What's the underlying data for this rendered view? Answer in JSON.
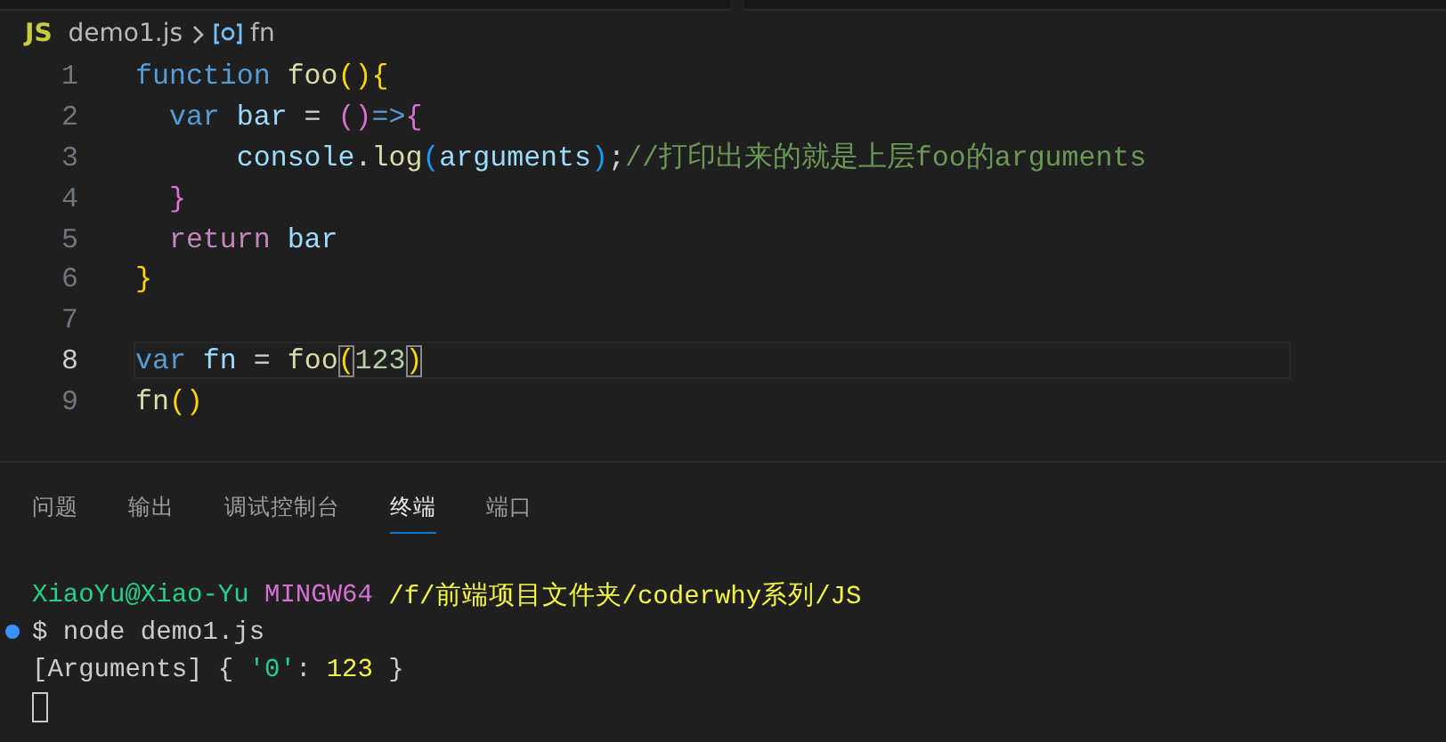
{
  "breadcrumb": {
    "file_icon": "JS",
    "file": "demo1.js",
    "symbol": "fn"
  },
  "editor": {
    "lines": [
      {
        "number": "1",
        "current": false,
        "tokens": [
          {
            "text": "function",
            "kind": "keyword"
          },
          {
            "text": " foo",
            "kind": "function"
          },
          {
            "text": "()",
            "kind": "bracket1"
          },
          {
            "text": "{",
            "kind": "bracket1"
          }
        ]
      },
      {
        "number": "2",
        "current": false,
        "tokens": [
          {
            "text": "  var",
            "kind": "keyword"
          },
          {
            "text": " bar",
            "kind": "variable"
          },
          {
            "text": " =",
            "kind": "plain"
          },
          {
            "text": " ()",
            "kind": "bracket2"
          },
          {
            "text": "=>",
            "kind": "keyword"
          },
          {
            "text": "{",
            "kind": "bracket2"
          }
        ]
      },
      {
        "number": "3",
        "current": false,
        "tokens": [
          {
            "text": "      console",
            "kind": "variable"
          },
          {
            "text": ".",
            "kind": "plain"
          },
          {
            "text": "log",
            "kind": "function"
          },
          {
            "text": "(",
            "kind": "bracket3"
          },
          {
            "text": "arguments",
            "kind": "variable"
          },
          {
            "text": ")",
            "kind": "bracket3"
          },
          {
            "text": ";",
            "kind": "plain"
          },
          {
            "text": "//打印出来的就是上层foo的arguments",
            "kind": "comment"
          }
        ]
      },
      {
        "number": "4",
        "current": false,
        "tokens": [
          {
            "text": "  }",
            "kind": "bracket2"
          }
        ]
      },
      {
        "number": "5",
        "current": false,
        "tokens": [
          {
            "text": "  return",
            "kind": "control"
          },
          {
            "text": " bar",
            "kind": "variable"
          }
        ]
      },
      {
        "number": "6",
        "current": false,
        "tokens": [
          {
            "text": "}",
            "kind": "bracket1"
          }
        ]
      },
      {
        "number": "7",
        "current": false
      },
      {
        "number": "8",
        "current": true,
        "tokens": [
          {
            "text": "var",
            "kind": "keyword"
          },
          {
            "text": " fn",
            "kind": "variable"
          },
          {
            "text": " =",
            "kind": "plain"
          },
          {
            "text": " foo",
            "kind": "function"
          },
          {
            "text": "(",
            "kind": "bracket1",
            "matched": true
          },
          {
            "text": "123",
            "kind": "number"
          },
          {
            "text": ")",
            "kind": "bracket1",
            "matched": true
          }
        ]
      },
      {
        "number": "9",
        "current": false,
        "tokens": [
          {
            "text": "fn",
            "kind": "function"
          },
          {
            "text": "()",
            "kind": "bracket1"
          }
        ]
      }
    ]
  },
  "panel": {
    "tabs": [
      {
        "label": "问题",
        "selected": false
      },
      {
        "label": "输出",
        "selected": false
      },
      {
        "label": "调试控制台",
        "selected": false
      },
      {
        "label": "终端",
        "selected": true
      },
      {
        "label": "端口",
        "selected": false
      }
    ],
    "terminal": {
      "lines": [
        {
          "marker": false,
          "segments": [
            {
              "text": "XiaoYu@Xiao-Yu",
              "kind": "green"
            },
            {
              "text": " MINGW64",
              "kind": "magenta"
            },
            {
              "text": " /f/前端项目文件夹/coderwhy系列/JS",
              "kind": "yellow"
            }
          ]
        },
        {
          "marker": true,
          "segments": [
            {
              "text": "$ node demo1.js",
              "kind": "plain"
            }
          ]
        },
        {
          "marker": false,
          "segments": [
            {
              "text": "[Arguments] { ",
              "kind": "plain"
            },
            {
              "text": "'0'",
              "kind": "green"
            },
            {
              "text": ": ",
              "kind": "plain"
            },
            {
              "text": "123",
              "kind": "yellow"
            },
            {
              "text": " }",
              "kind": "plain"
            }
          ]
        }
      ],
      "cursor": true
    }
  }
}
